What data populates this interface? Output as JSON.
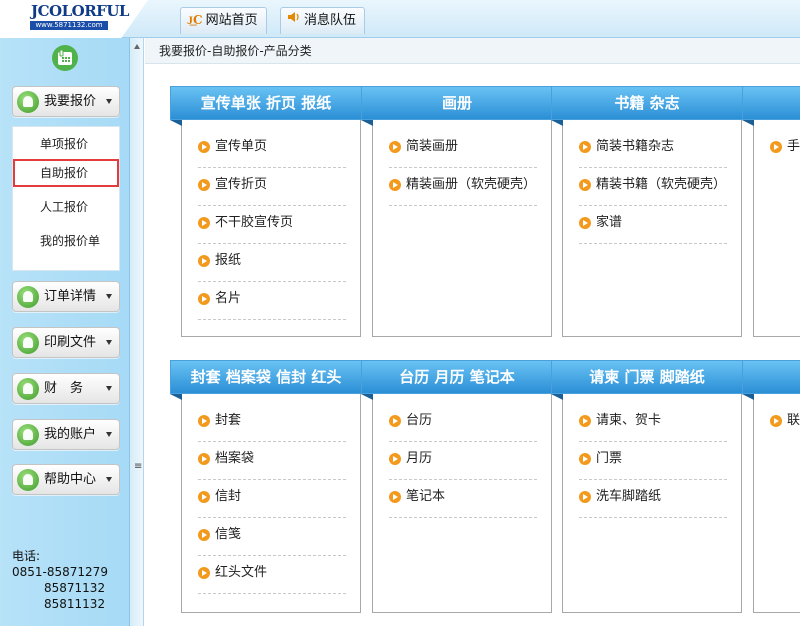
{
  "brand": {
    "name": "JCOLORFUL",
    "url": "www.5871132.com"
  },
  "top_tabs": [
    {
      "icon": "jc-logo-icon",
      "label": "网站首页"
    },
    {
      "icon": "speaker-icon",
      "label": "消息队伍"
    }
  ],
  "sidebar": {
    "menus": [
      {
        "label": "我要报价",
        "icon": "quote-icon"
      },
      {
        "label": "订单详情",
        "icon": "order-icon"
      },
      {
        "label": "印刷文件",
        "icon": "print-file-icon"
      },
      {
        "label": "财　务",
        "icon": "finance-search-icon"
      },
      {
        "label": "我的账户",
        "icon": "account-icon"
      },
      {
        "label": "帮助中心",
        "icon": "help-icon"
      }
    ],
    "submenu": [
      {
        "label": "单项报价"
      },
      {
        "label": "自助报价",
        "selected": true
      },
      {
        "label": "人工报价"
      },
      {
        "label": "我的报价单"
      }
    ],
    "contact": {
      "label": "电话:",
      "phones": [
        "0851-85871279",
        "85871132",
        "85811132"
      ]
    }
  },
  "breadcrumb": "我要报价-自助报价-产品分类",
  "categories_row1": [
    {
      "title": "宣传单张 折页 报纸",
      "items": [
        "宣传单页",
        "宣传折页",
        "不干胶宣传页",
        "报纸",
        "名片"
      ]
    },
    {
      "title": "画册",
      "items": [
        "简装画册",
        "精装画册（软壳硬壳）"
      ]
    },
    {
      "title": "书籍 杂志",
      "items": [
        "简装书籍杂志",
        "精装书籍（软壳硬壳）",
        "家谱"
      ]
    },
    {
      "title": "",
      "items": [
        "手"
      ]
    }
  ],
  "categories_row2": [
    {
      "title": "封套 档案袋 信封 红头",
      "items": [
        "封套",
        "档案袋",
        "信封",
        "信笺",
        "红头文件"
      ]
    },
    {
      "title": "台历 月历 笔记本",
      "items": [
        "台历",
        "月历",
        "笔记本"
      ]
    },
    {
      "title": "请柬 门票 脚踏纸",
      "items": [
        "请柬、贺卡",
        "门票",
        "洗车脚踏纸"
      ]
    },
    {
      "title": "",
      "items": [
        "联"
      ]
    }
  ],
  "colors": {
    "header_blue": "#2b8fd6",
    "bullet_orange": "#f39a1d",
    "sidebar_bg": "#a6daf6",
    "selected_border": "#e23c3c"
  }
}
